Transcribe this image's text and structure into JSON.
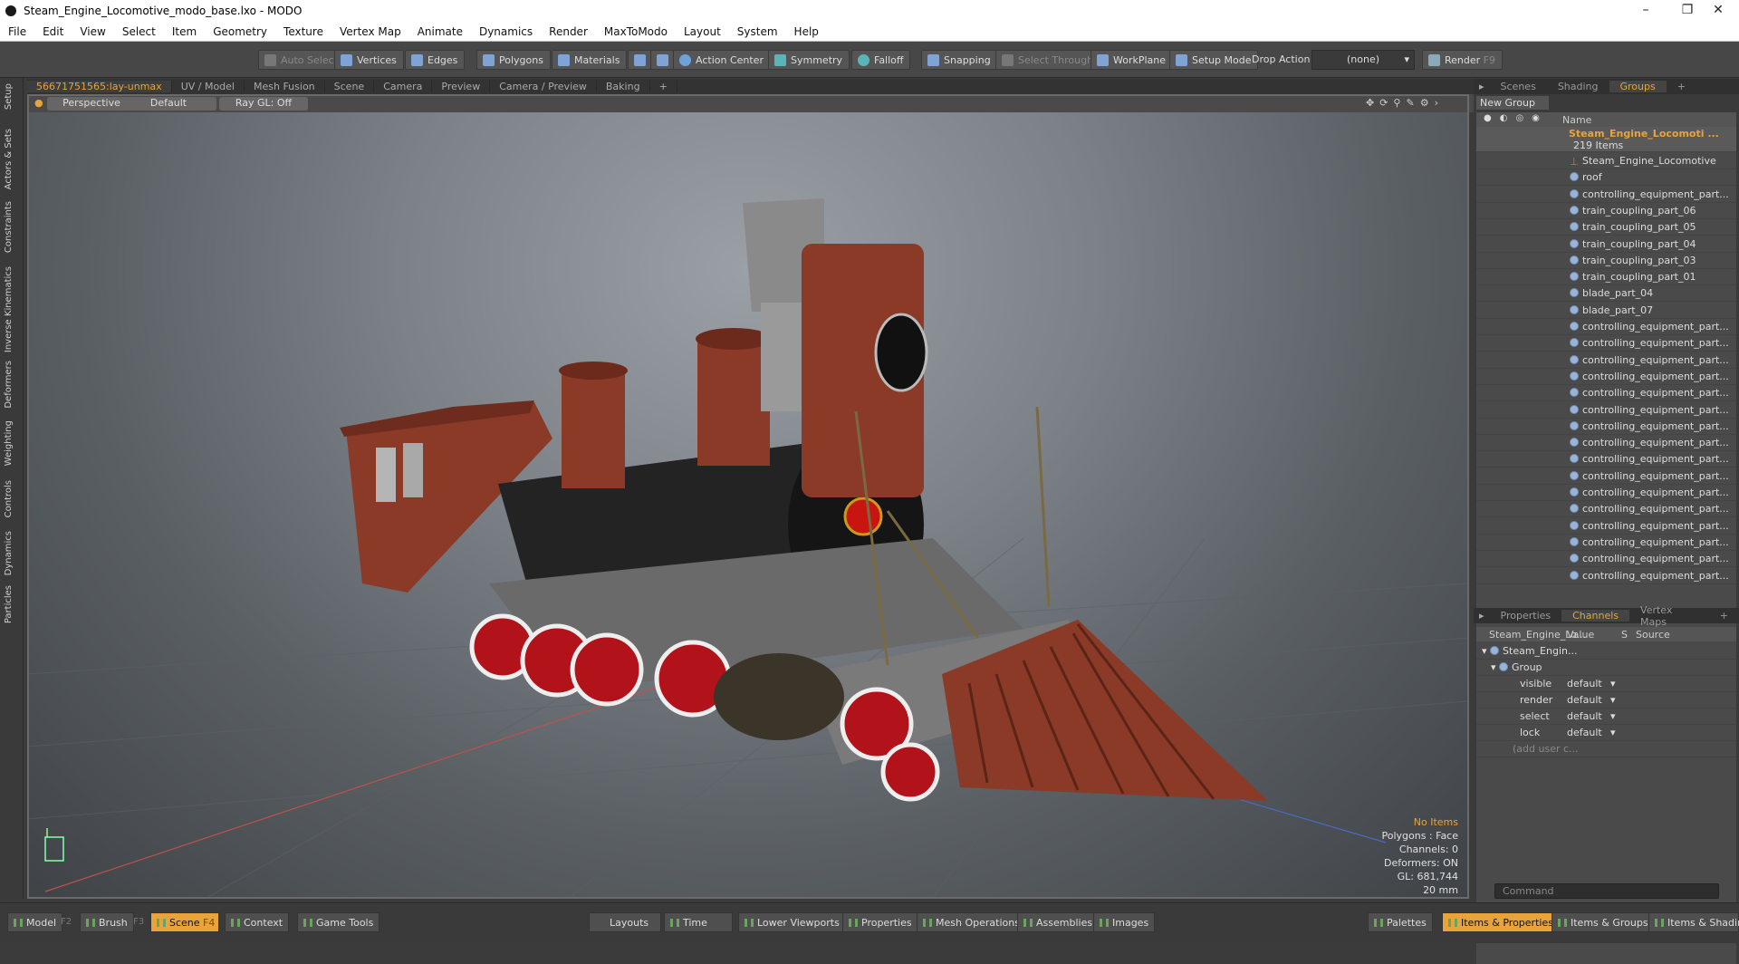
{
  "window": {
    "title": "Steam_Engine_Locomotive_modo_base.lxo - MODO"
  },
  "menu": [
    "File",
    "Edit",
    "View",
    "Select",
    "Item",
    "Geometry",
    "Texture",
    "Vertex Map",
    "Animate",
    "Dynamics",
    "Render",
    "MaxToModo",
    "Layout",
    "System",
    "Help"
  ],
  "toolbar": {
    "auto_select": "Auto Select",
    "vertices": "Vertices",
    "edges": "Edges",
    "polygons": "Polygons",
    "materials": "Materials",
    "action_center": "Action Center",
    "symmetry": "Symmetry",
    "falloff": "Falloff",
    "snapping": "Snapping",
    "select_through": "Select Through",
    "workplane": "WorkPlane",
    "setup_mode": "Setup Mode",
    "drop_action": "Drop Action",
    "drop_value": "(none)",
    "render": "Render",
    "render_key": "F9"
  },
  "left_tabs": [
    "Setup",
    "Actors & Sets",
    "Constraints",
    "Inverse Kinematics",
    "Deformers",
    "Weighting",
    "Controls",
    "Dynamics",
    "Particles"
  ],
  "viewport_tabs": [
    "56671751565:lay-unmax",
    "UV / Model",
    "Mesh Fusion",
    "Scene",
    "Camera",
    "Preview",
    "Camera / Preview",
    "Baking",
    "+"
  ],
  "viewport": {
    "perspective": "Perspective",
    "default": "Default",
    "raygl": "Ray GL: Off"
  },
  "info": {
    "items": "No Items",
    "polygons": "Polygons : Face",
    "channels": "Channels: 0",
    "deformers": "Deformers: ON",
    "gl": "GL: 681,744",
    "scale": "20 mm"
  },
  "groups_panel": {
    "tabs": [
      "Scenes",
      "Shading",
      "Groups",
      "+"
    ],
    "new_group": "New Group",
    "name_header": "Name",
    "root": "Steam_Engine_Locomoti ...",
    "count": "219 Items",
    "items": [
      "Steam_Engine_Locomotive",
      "roof",
      "controlling_equipment_part...",
      "train_coupling_part_06",
      "train_coupling_part_05",
      "train_coupling_part_04",
      "train_coupling_part_03",
      "train_coupling_part_01",
      "blade_part_04",
      "blade_part_07",
      "controlling_equipment_part...",
      "controlling_equipment_part...",
      "controlling_equipment_part...",
      "controlling_equipment_part...",
      "controlling_equipment_part...",
      "controlling_equipment_part...",
      "controlling_equipment_part...",
      "controlling_equipment_part...",
      "controlling_equipment_part...",
      "controlling_equipment_part...",
      "controlling_equipment_part...",
      "controlling_equipment_part...",
      "controlling_equipment_part...",
      "controlling_equipment_part...",
      "controlling_equipment_part...",
      "controlling_equipment_part..."
    ]
  },
  "channels_panel": {
    "tabs": [
      "Properties",
      "Channels",
      "Vertex Maps",
      "+"
    ],
    "headers": [
      "Steam_Engine_Lo...",
      "Value",
      "S",
      "Source"
    ],
    "root": "Steam_Engin...",
    "group": "Group",
    "rows": [
      {
        "name": "visible",
        "value": "default"
      },
      {
        "name": "render",
        "value": "default"
      },
      {
        "name": "select",
        "value": "default"
      },
      {
        "name": "lock",
        "value": "default"
      }
    ],
    "add": "(add user c..."
  },
  "command": {
    "placeholder": "Command"
  },
  "bottom": {
    "model": "Model",
    "f2": "F2",
    "brush": "Brush",
    "f3": "F3",
    "scene": "Scene",
    "f4": "F4",
    "context": "Context",
    "game_tools": "Game Tools",
    "layouts": "Layouts",
    "time": "Time",
    "lower_viewports": "Lower Viewports",
    "properties": "Properties",
    "mesh_operations": "Mesh Operations",
    "assemblies": "Assemblies",
    "images": "Images",
    "palettes": "Palettes",
    "items_properties": "Items & Properties",
    "items_groups": "Items & Groups",
    "items_shading": "Items & Shading"
  }
}
